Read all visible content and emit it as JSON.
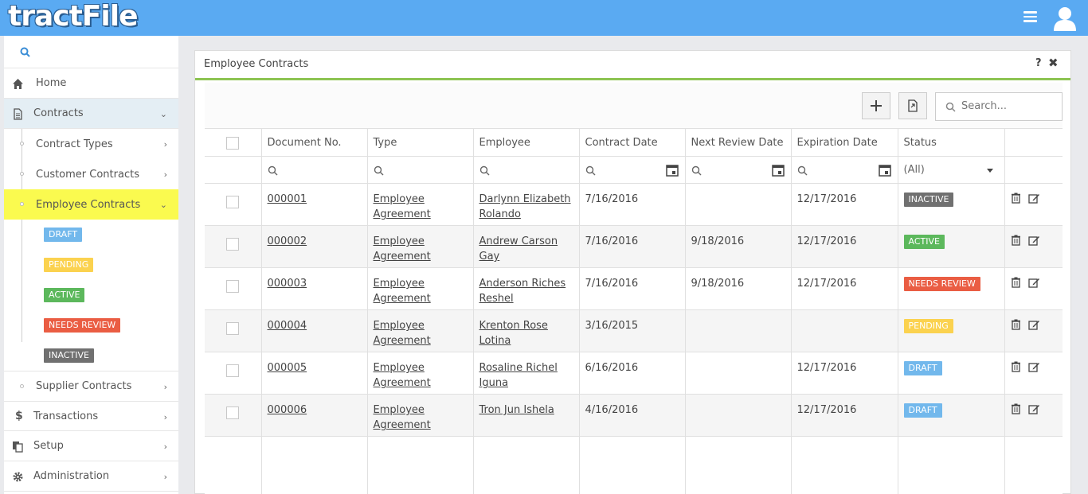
{
  "app": {
    "logo": "tractFile"
  },
  "sidebar": {
    "items": [
      {
        "label": "Home"
      },
      {
        "label": "Contracts"
      },
      {
        "label": "Transactions"
      },
      {
        "label": "Setup"
      },
      {
        "label": "Administration"
      }
    ],
    "contracts_sub": [
      {
        "label": "Contract Types"
      },
      {
        "label": "Customer Contracts"
      },
      {
        "label": "Employee Contracts"
      },
      {
        "label": "Supplier Contracts"
      }
    ],
    "status_tags": [
      "DRAFT",
      "PENDING",
      "ACTIVE",
      "NEEDS REVIEW",
      "INACTIVE"
    ]
  },
  "panel": {
    "title": "Employee Contracts",
    "help": "?",
    "close": "✖",
    "search_placeholder": "Search..."
  },
  "grid": {
    "columns": [
      "Document No.",
      "Type",
      "Employee",
      "Contract Date",
      "Next Review Date",
      "Expiration Date",
      "Status"
    ],
    "status_filter": "(All)",
    "rows": [
      {
        "doc": "000001",
        "type": "Employee Agreement",
        "employee": "Darlynn Elizabeth Rolando",
        "contract_date": "7/16/2016",
        "review_date": "",
        "expiration": "12/17/2016",
        "status": "INACTIVE",
        "status_class": "inactive"
      },
      {
        "doc": "000002",
        "type": "Employee Agreement",
        "employee": "Andrew Carson Gay",
        "contract_date": "7/16/2016",
        "review_date": "9/18/2016",
        "expiration": "12/17/2016",
        "status": "ACTIVE",
        "status_class": "active"
      },
      {
        "doc": "000003",
        "type": "Employee Agreement",
        "employee": "Anderson Riches Reshel",
        "contract_date": "7/16/2016",
        "review_date": "9/18/2016",
        "expiration": "12/17/2016",
        "status": "NEEDS REVIEW",
        "status_class": "review"
      },
      {
        "doc": "000004",
        "type": "Employee Agreement",
        "employee": "Krenton Rose Lotina",
        "contract_date": "3/16/2015",
        "review_date": "",
        "expiration": "",
        "status": "PENDING",
        "status_class": "pending"
      },
      {
        "doc": "000005",
        "type": "Employee Agreement",
        "employee": "Rosaline Richel Iguna",
        "contract_date": "6/16/2016",
        "review_date": "",
        "expiration": "12/17/2016",
        "status": "DRAFT",
        "status_class": "draft"
      },
      {
        "doc": "000006",
        "type": "Employee Agreement",
        "employee": "Tron Jun Ishela",
        "contract_date": "4/16/2016",
        "review_date": "",
        "expiration": "12/17/2016",
        "status": "DRAFT",
        "status_class": "draft"
      }
    ]
  },
  "colors": {
    "topbar": "#5aaaf2",
    "accent_green": "#8dc452",
    "highlight": "#fafa4f",
    "draft": "#72b8ec",
    "pending": "#fbd24f",
    "active": "#5cb85c",
    "needs_review": "#ea5d43",
    "inactive": "#707070"
  }
}
